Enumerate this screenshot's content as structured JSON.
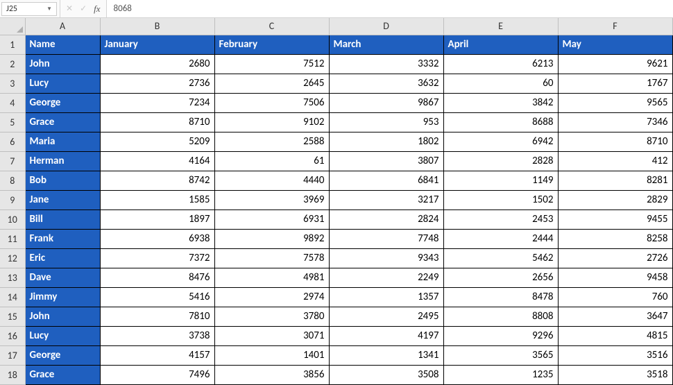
{
  "formula_bar": {
    "name_box": "J25",
    "formula_value": "8068",
    "fx_label": "fx",
    "cancel_icon": "✕",
    "confirm_icon": "✓"
  },
  "column_letters": [
    "A",
    "B",
    "C",
    "D",
    "E",
    "F"
  ],
  "row_numbers": [
    "1",
    "2",
    "3",
    "4",
    "5",
    "6",
    "7",
    "8",
    "9",
    "10",
    "11",
    "12",
    "13",
    "14",
    "15",
    "16",
    "17",
    "18"
  ],
  "headers": {
    "name": "Name",
    "jan": "January",
    "feb": "February",
    "mar": "March",
    "apr": "April",
    "may": "May"
  },
  "rows": [
    {
      "name": "John",
      "jan": "2680",
      "feb": "7512",
      "mar": "3332",
      "apr": "6213",
      "may": "9621"
    },
    {
      "name": "Lucy",
      "jan": "2736",
      "feb": "2645",
      "mar": "3632",
      "apr": "60",
      "may": "1767"
    },
    {
      "name": "George",
      "jan": "7234",
      "feb": "7506",
      "mar": "9867",
      "apr": "3842",
      "may": "9565"
    },
    {
      "name": "Grace",
      "jan": "8710",
      "feb": "9102",
      "mar": "953",
      "apr": "8688",
      "may": "7346"
    },
    {
      "name": "Maria",
      "jan": "5209",
      "feb": "2588",
      "mar": "1802",
      "apr": "6942",
      "may": "8710"
    },
    {
      "name": "Herman",
      "jan": "4164",
      "feb": "61",
      "mar": "3807",
      "apr": "2828",
      "may": "412"
    },
    {
      "name": "Bob",
      "jan": "8742",
      "feb": "4440",
      "mar": "6841",
      "apr": "1149",
      "may": "8281"
    },
    {
      "name": "Jane",
      "jan": "1585",
      "feb": "3969",
      "mar": "3217",
      "apr": "1502",
      "may": "2829"
    },
    {
      "name": "Bill",
      "jan": "1897",
      "feb": "6931",
      "mar": "2824",
      "apr": "2453",
      "may": "9455"
    },
    {
      "name": "Frank",
      "jan": "6938",
      "feb": "9892",
      "mar": "7748",
      "apr": "2444",
      "may": "8258"
    },
    {
      "name": "Eric",
      "jan": "7372",
      "feb": "7578",
      "mar": "9343",
      "apr": "5462",
      "may": "2726"
    },
    {
      "name": "Dave",
      "jan": "8476",
      "feb": "4981",
      "mar": "2249",
      "apr": "2656",
      "may": "9458"
    },
    {
      "name": "Jimmy",
      "jan": "5416",
      "feb": "2974",
      "mar": "1357",
      "apr": "8478",
      "may": "760"
    },
    {
      "name": "John",
      "jan": "7810",
      "feb": "3780",
      "mar": "2495",
      "apr": "8808",
      "may": "3647"
    },
    {
      "name": "Lucy",
      "jan": "3738",
      "feb": "3071",
      "mar": "4197",
      "apr": "9296",
      "may": "4815"
    },
    {
      "name": "George",
      "jan": "4157",
      "feb": "1401",
      "mar": "1341",
      "apr": "3565",
      "may": "3516"
    },
    {
      "name": "Grace",
      "jan": "7496",
      "feb": "3856",
      "mar": "3508",
      "apr": "1235",
      "may": "3518"
    }
  ]
}
